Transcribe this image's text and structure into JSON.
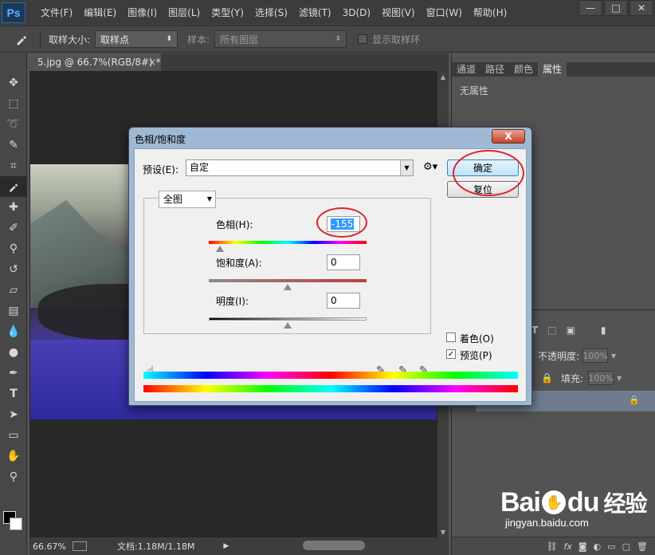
{
  "app": {
    "logo": "Ps"
  },
  "menu": [
    "文件(F)",
    "编辑(E)",
    "图像(I)",
    "图层(L)",
    "类型(Y)",
    "选择(S)",
    "滤镜(T)",
    "3D(D)",
    "视图(V)",
    "窗口(W)",
    "帮助(H)"
  ],
  "window_controls": {
    "minimize": "—",
    "restore": "□",
    "close": "✕"
  },
  "options": {
    "sample_size_label": "取样大小:",
    "sample_size_value": "取样点",
    "sample_label": "样本:",
    "sample_value": "所有图层",
    "show_ring_label": "显示取样环"
  },
  "document": {
    "tab_title": "5.jpg @ 66.7%(RGB/8#) *",
    "tab_close": "×"
  },
  "status": {
    "zoom": "66.67%",
    "doc_info": "文档:1.18M/1.18M"
  },
  "panels": {
    "tabs": [
      "通道",
      "路径",
      "颜色",
      "属性"
    ],
    "active_tab": "属性",
    "properties_text": "无属性",
    "opacity_label": "不透明度:",
    "opacity_value": "100%",
    "fill_label": "填充:",
    "fill_value": "100%"
  },
  "watermark": {
    "brand_a": "Bai",
    "brand_b": "du",
    "brand_cn": "经验",
    "url": "jingyan.baidu.com"
  },
  "dialog": {
    "title": "色相/饱和度",
    "close": "X",
    "preset_label": "预设(E):",
    "preset_value": "自定",
    "ok_button": "确定",
    "reset_button": "复位",
    "range_value": "全图",
    "hue_label": "色相(H):",
    "hue_value": "-155",
    "saturation_label": "饱和度(A):",
    "saturation_value": "0",
    "lightness_label": "明度(I):",
    "lightness_value": "0",
    "colorize_label": "着色(O)",
    "colorize_checked": false,
    "preview_label": "预览(P)",
    "preview_checked": true
  },
  "slider_levels": {
    "hue": -155,
    "hue_min": -180,
    "hue_max": 180,
    "saturation": 0,
    "lightness": 0
  },
  "colors": {
    "accent_highlight": "#3399ff",
    "annotation_circle": "#d9242b"
  }
}
